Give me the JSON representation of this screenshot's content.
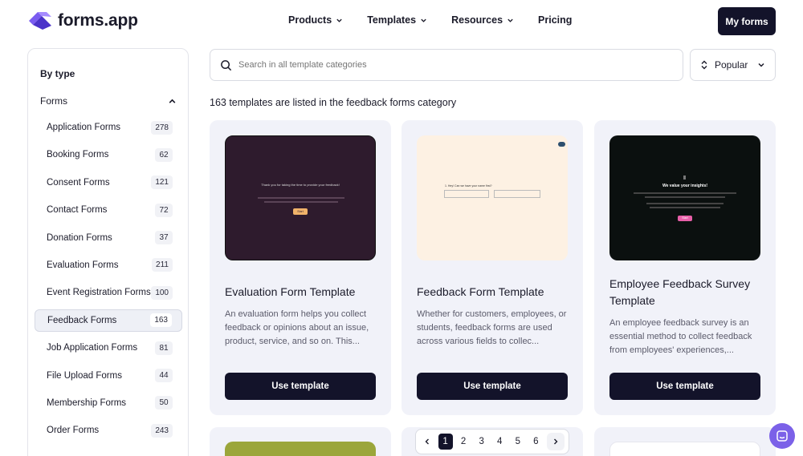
{
  "header": {
    "logo_text": "forms.app",
    "nav": [
      {
        "label": "Products"
      },
      {
        "label": "Templates"
      },
      {
        "label": "Resources"
      },
      {
        "label": "Pricing"
      }
    ],
    "my_forms": "My forms"
  },
  "sidebar": {
    "by_type": "By type",
    "forms_label": "Forms",
    "items": [
      {
        "label": "Application Forms",
        "count": "278"
      },
      {
        "label": "Booking Forms",
        "count": "62"
      },
      {
        "label": "Consent Forms",
        "count": "121"
      },
      {
        "label": "Contact Forms",
        "count": "72"
      },
      {
        "label": "Donation Forms",
        "count": "37"
      },
      {
        "label": "Evaluation Forms",
        "count": "211"
      },
      {
        "label": "Event Registration Forms",
        "count": "100"
      },
      {
        "label": "Feedback Forms",
        "count": "163"
      },
      {
        "label": "Job Application Forms",
        "count": "81"
      },
      {
        "label": "File Upload Forms",
        "count": "44"
      },
      {
        "label": "Membership Forms",
        "count": "50"
      },
      {
        "label": "Order Forms",
        "count": "243"
      }
    ]
  },
  "search": {
    "placeholder": "Search in all template categories"
  },
  "sort": {
    "label": "Popular"
  },
  "count_text": "163 templates are listed in the feedback forms category",
  "cards": [
    {
      "title": "Evaluation Form Template",
      "desc": "An evaluation form helps you collect feedback or opinions about an issue, product, service, and so on. This...",
      "button": "Use template",
      "preview_heading": "Thank you for taking the time to provide your feedback!",
      "preview_button": "Start"
    },
    {
      "title": "Feedback Form Template",
      "desc": "Whether for customers, employees, or students, feedback forms are used across various fields to collec...",
      "button": "Use template",
      "preview_heading": "1. Hey! Can we have your name first?"
    },
    {
      "title": "Employee Feedback Survey Template",
      "desc": "An employee feedback survey is an essential method to collect feedback from employees' experiences,...",
      "button": "Use template",
      "preview_heading": "We value your insights!",
      "preview_button": "Start"
    }
  ],
  "pagination": {
    "pages": [
      "1",
      "2",
      "3",
      "4",
      "5",
      "6"
    ],
    "current": "1"
  },
  "colors": {
    "primary": "#13132a",
    "card_bg": "#f1f2f9",
    "chat": "#7b61e8"
  }
}
